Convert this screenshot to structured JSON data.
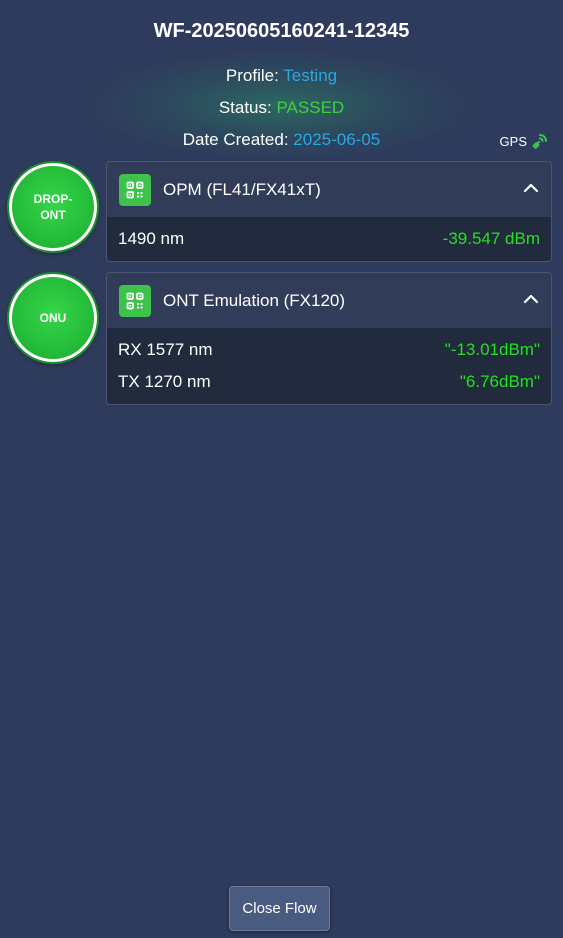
{
  "flow": {
    "id": "WF-20250605160241-12345",
    "profile_label": "Profile:",
    "profile_value": "Testing",
    "status_label": "Status:",
    "status_value": "PASSED",
    "date_label": "Date Created:",
    "date_value": "2025-06-05",
    "gps_label": "GPS"
  },
  "nodes": [
    {
      "circle_label_line1": "DROP-",
      "circle_label_line2": "ONT",
      "card_title": "OPM (FL41/FX41xT)",
      "rows": [
        {
          "key": "1490 nm",
          "value": "-39.547 dBm"
        }
      ]
    },
    {
      "circle_label_line1": "ONU",
      "card_title": "ONT Emulation (FX120)",
      "rows": [
        {
          "key": "RX 1577 nm",
          "value": "\"-13.01dBm\""
        },
        {
          "key": "TX 1270 nm",
          "value": "\"6.76dBm\""
        }
      ]
    }
  ],
  "footer": {
    "close_label": "Close Flow"
  },
  "icons": {
    "qr": "qr-code-icon",
    "chevron": "chevron-up-icon",
    "gps": "satellite-signal-icon"
  },
  "colors": {
    "background": "#2e3b5c",
    "accent_blue": "#2aa8e0",
    "status_green": "#3fcf3f",
    "value_green": "#22e022",
    "node_green": "#22b836"
  }
}
